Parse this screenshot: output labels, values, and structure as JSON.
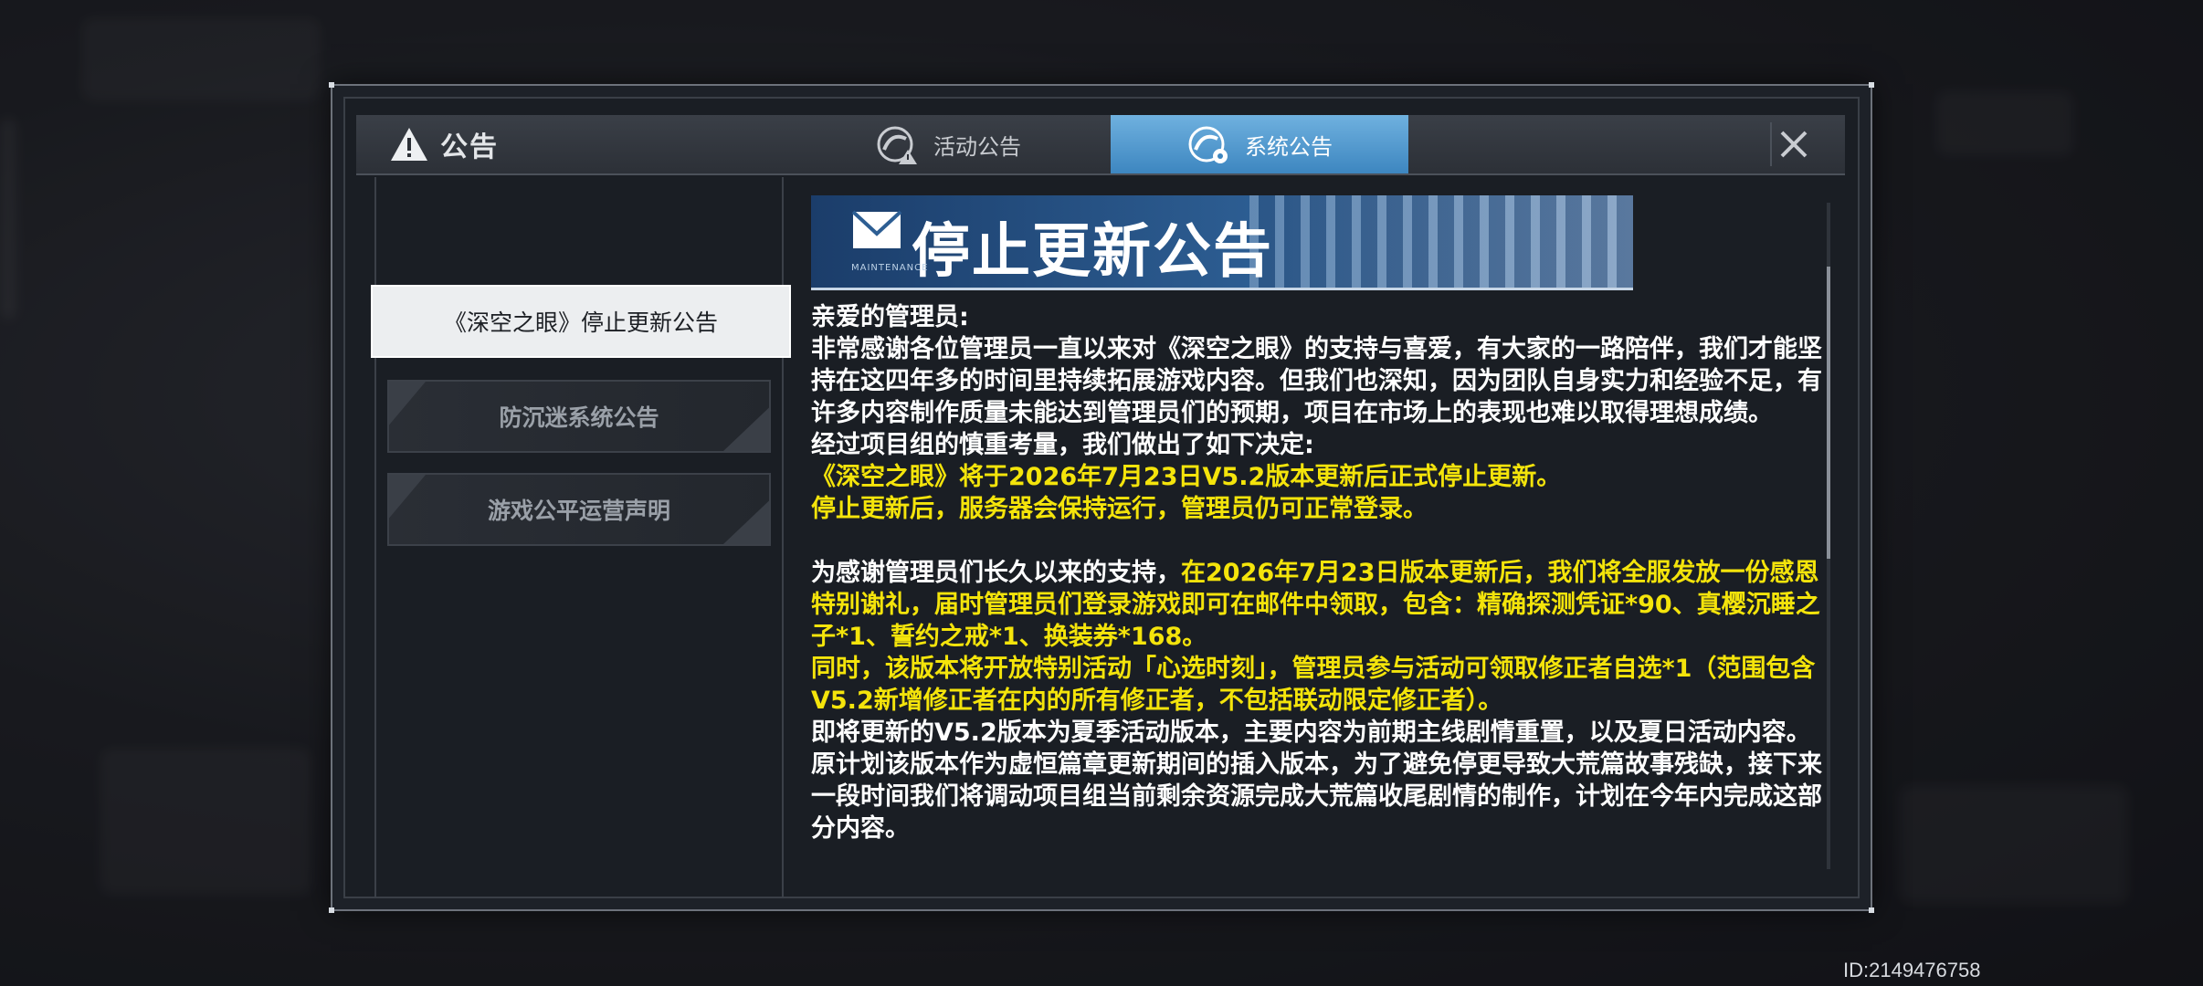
{
  "dialog": {
    "title": "公告",
    "tabs": [
      {
        "label": "活动公告",
        "active": false
      },
      {
        "label": "系统公告",
        "active": true
      }
    ],
    "close_icon": "close-icon"
  },
  "sidebar": {
    "items": [
      {
        "label": "《深空之眼》停止更新公告",
        "active": true
      },
      {
        "label": "防沉迷系统公告",
        "active": false
      },
      {
        "label": "游戏公平运营声明",
        "active": false
      }
    ]
  },
  "banner": {
    "title": "停止更新公告",
    "subtitle": "MAINTENANCE"
  },
  "notice": {
    "p1": "亲爱的管理员:",
    "p2": "非常感谢各位管理员一直以来对《深空之眼》的支持与喜爱，有大家的一路陪伴，我们才能坚持在这四年多的时间里持续拓展游戏内容。但我们也深知，因为团队自身实力和经验不足，有许多内容制作质量未能达到管理员们的预期，项目在市场上的表现也难以取得理想成绩。",
    "p3": "经过项目组的慎重考量，我们做出了如下决定:",
    "p4": "《深空之眼》将于2026年7月23日V5.2版本更新后正式停止更新。",
    "p5": "停止更新后，服务器会保持运行，管理员仍可正常登录。",
    "p6a": "为感谢管理员们长久以来的支持，",
    "p6b": "在2026年7月23日版本更新后，我们将全服发放一份感恩特别谢礼，届时管理员们登录游戏即可在邮件中领取，包含：精确探测凭证*90、真樱沉睡之子*1、誓约之戒*1、换装券*168。",
    "p7": "同时，该版本将开放特别活动「心选时刻」，管理员参与活动可领取修正者自选*1（范围包含V5.2新增修正者在内的所有修正者，不包括联动限定修正者）。",
    "p8": "即将更新的V5.2版本为夏季活动版本，主要内容为前期主线剧情重置，以及夏日活动内容。原计划该版本作为虚恒篇章更新期间的插入版本，为了避免停更导致大荒篇故事残缺，接下来一段时间我们将调动项目组当前剩余资源完成大荒篇收尾剧情的制作，计划在今年内完成这部分内容。"
  },
  "footer": {
    "uid": "ID:2149476758"
  },
  "colors": {
    "highlight": "#f4e40b",
    "tab_active": "#4a95cd"
  }
}
